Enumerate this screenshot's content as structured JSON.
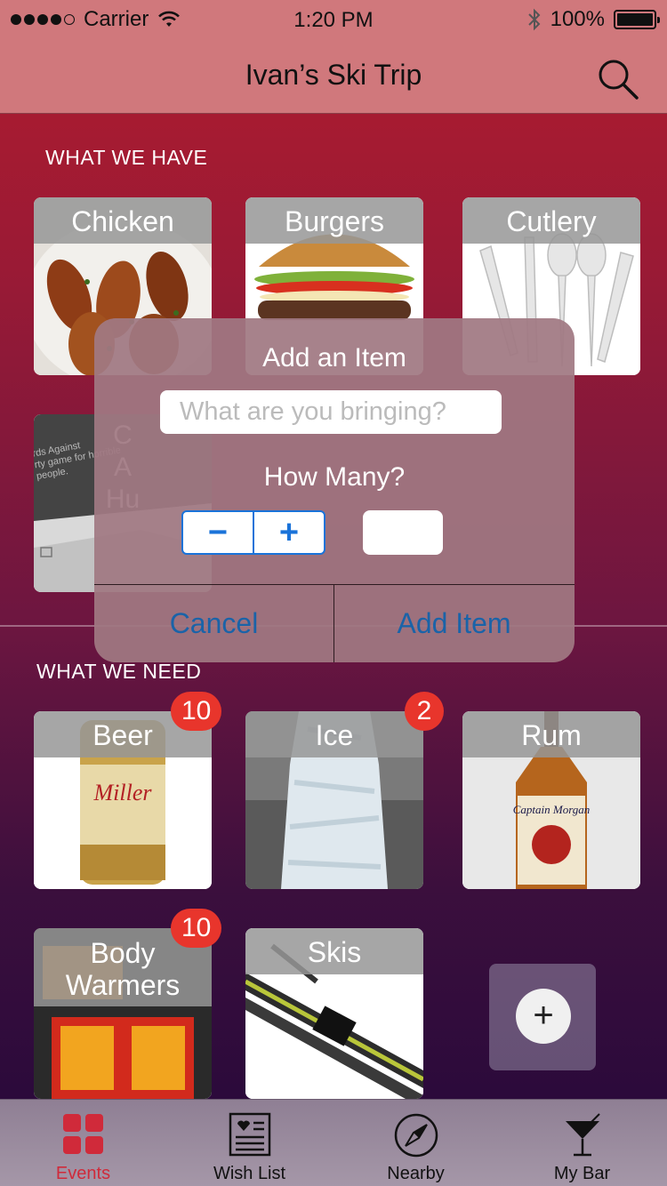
{
  "status_bar": {
    "carrier": "Carrier",
    "time": "1:20 PM",
    "battery": "100%"
  },
  "nav": {
    "title": "Ivan’s Ski Trip",
    "search_icon": "search-icon"
  },
  "sections": {
    "have_label": "WHAT WE HAVE",
    "need_label": "WHAT WE NEED"
  },
  "have_items": [
    {
      "name": "Chicken"
    },
    {
      "name": "Burgers"
    },
    {
      "name": "Cutlery"
    }
  ],
  "have_partial_text": {
    "line1": "C",
    "line2": "A",
    "line3": "Hu",
    "box_print_1": "rds Against",
    "box_print_2": "rty game for horrible people."
  },
  "need_items": [
    {
      "name": "Beer",
      "count": "10"
    },
    {
      "name": "Ice",
      "count": "2"
    },
    {
      "name": "Rum"
    },
    {
      "name": "Body Warmers",
      "count": "10"
    },
    {
      "name": "Skis"
    }
  ],
  "add_tile": {
    "icon": "plus-icon",
    "symbol": "+"
  },
  "dialog": {
    "title": "Add an Item",
    "input_placeholder": "What are you bringing?",
    "input_value": "",
    "quantity_label": "How Many?",
    "minus": "−",
    "plus": "+",
    "quantity_value": "",
    "cancel": "Cancel",
    "confirm": "Add Item"
  },
  "tabs": [
    {
      "label": "Events",
      "icon": "grid-icon",
      "active": true
    },
    {
      "label": "Wish List",
      "icon": "list-icon",
      "active": false
    },
    {
      "label": "Nearby",
      "icon": "compass-icon",
      "active": false
    },
    {
      "label": "My Bar",
      "icon": "cocktail-icon",
      "active": false
    }
  ],
  "colors": {
    "accent_active_tab": "#d02a3a",
    "badge": "#e8352c",
    "link_blue": "#1a63a8"
  }
}
